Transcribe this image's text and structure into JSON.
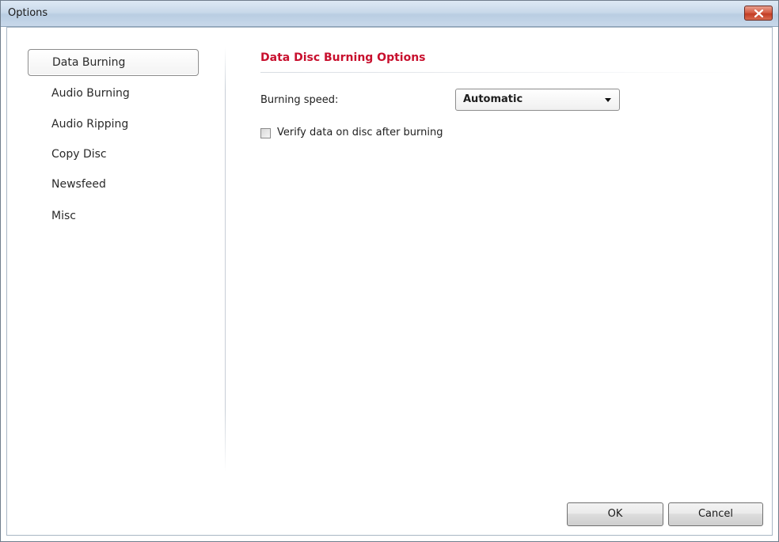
{
  "window": {
    "title": "Options",
    "close_icon": "close-icon"
  },
  "sidebar": {
    "items": [
      {
        "label": "Data Burning",
        "selected": true
      },
      {
        "label": "Audio Burning",
        "selected": false
      },
      {
        "label": "Audio Ripping",
        "selected": false
      },
      {
        "label": "Copy Disc",
        "selected": false
      },
      {
        "label": "Newsfeed",
        "selected": false
      },
      {
        "label": "Misc",
        "selected": false
      }
    ]
  },
  "panel": {
    "title": "Data Disc Burning Options",
    "speed_label": "Burning speed:",
    "speed_value": "Automatic",
    "verify_label": "Verify data on disc after burning",
    "verify_checked": false
  },
  "footer": {
    "ok_label": "OK",
    "cancel_label": "Cancel"
  },
  "colors": {
    "accent_title": "#c8102e",
    "close_button": "#c23c23"
  }
}
